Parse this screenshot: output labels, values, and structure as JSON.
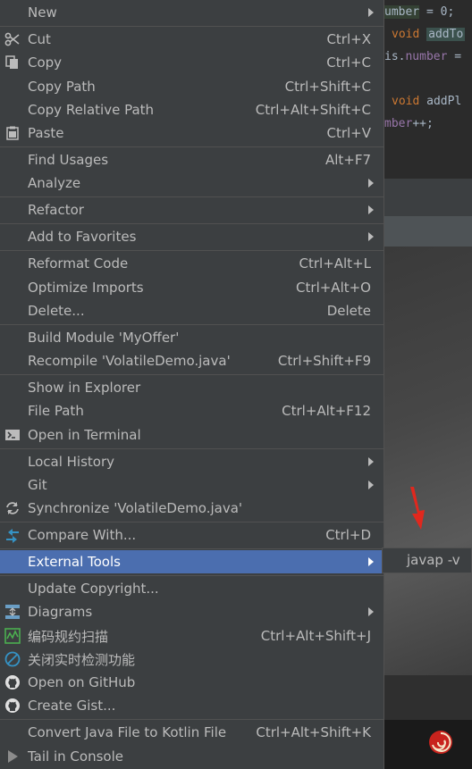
{
  "editor": {
    "line1_field": "umber",
    "line1_rest": " = 0;",
    "line2_kw": "void",
    "line2_method": "addTo",
    "line3_this": "is.",
    "line3_field": "number",
    "line3_rest": " =",
    "line5_kw": "void",
    "line5_method": "addPl",
    "line6_field": "mber",
    "line6_rest": "++;"
  },
  "menu": {
    "items": [
      {
        "label": "New",
        "shortcut": "",
        "submenu": true,
        "icon": ""
      },
      {
        "label": "Cut",
        "shortcut": "Ctrl+X",
        "submenu": false,
        "icon": "scissors-icon"
      },
      {
        "label": "Copy",
        "shortcut": "Ctrl+C",
        "submenu": false,
        "icon": "copy-icon"
      },
      {
        "label": "Copy Path",
        "shortcut": "Ctrl+Shift+C",
        "submenu": false,
        "icon": ""
      },
      {
        "label": "Copy Relative Path",
        "shortcut": "Ctrl+Alt+Shift+C",
        "submenu": false,
        "icon": ""
      },
      {
        "label": "Paste",
        "shortcut": "Ctrl+V",
        "submenu": false,
        "icon": "clipboard-icon"
      },
      {
        "label": "Find Usages",
        "shortcut": "Alt+F7",
        "submenu": false,
        "icon": ""
      },
      {
        "label": "Analyze",
        "shortcut": "",
        "submenu": true,
        "icon": ""
      },
      {
        "label": "Refactor",
        "shortcut": "",
        "submenu": true,
        "icon": ""
      },
      {
        "label": "Add to Favorites",
        "shortcut": "",
        "submenu": true,
        "icon": ""
      },
      {
        "label": "Reformat Code",
        "shortcut": "Ctrl+Alt+L",
        "submenu": false,
        "icon": ""
      },
      {
        "label": "Optimize Imports",
        "shortcut": "Ctrl+Alt+O",
        "submenu": false,
        "icon": ""
      },
      {
        "label": "Delete...",
        "shortcut": "Delete",
        "submenu": false,
        "icon": ""
      },
      {
        "label": "Build Module 'MyOffer'",
        "shortcut": "",
        "submenu": false,
        "icon": ""
      },
      {
        "label": "Recompile 'VolatileDemo.java'",
        "shortcut": "Ctrl+Shift+F9",
        "submenu": false,
        "icon": ""
      },
      {
        "label": "Show in Explorer",
        "shortcut": "",
        "submenu": false,
        "icon": ""
      },
      {
        "label": "File Path",
        "shortcut": "Ctrl+Alt+F12",
        "submenu": false,
        "icon": ""
      },
      {
        "label": "Open in Terminal",
        "shortcut": "",
        "submenu": false,
        "icon": "terminal-icon"
      },
      {
        "label": "Local History",
        "shortcut": "",
        "submenu": true,
        "icon": ""
      },
      {
        "label": "Git",
        "shortcut": "",
        "submenu": true,
        "icon": ""
      },
      {
        "label": "Synchronize 'VolatileDemo.java'",
        "shortcut": "",
        "submenu": false,
        "icon": "sync-icon"
      },
      {
        "label": "Compare With...",
        "shortcut": "Ctrl+D",
        "submenu": false,
        "icon": "compare-icon"
      },
      {
        "label": "External Tools",
        "shortcut": "",
        "submenu": true,
        "icon": "",
        "selected": true
      },
      {
        "label": "Update Copyright...",
        "shortcut": "",
        "submenu": false,
        "icon": ""
      },
      {
        "label": "Diagrams",
        "shortcut": "",
        "submenu": true,
        "icon": "diagram-icon"
      },
      {
        "label": "编码规约扫描",
        "shortcut": "Ctrl+Alt+Shift+J",
        "submenu": false,
        "icon": "scan-icon"
      },
      {
        "label": "关闭实时检测功能",
        "shortcut": "",
        "submenu": false,
        "icon": "disable-icon"
      },
      {
        "label": "Open on GitHub",
        "shortcut": "",
        "submenu": false,
        "icon": "github-icon"
      },
      {
        "label": "Create Gist...",
        "shortcut": "",
        "submenu": false,
        "icon": "github-icon"
      },
      {
        "label": "Convert Java File to Kotlin File",
        "shortcut": "Ctrl+Alt+Shift+K",
        "submenu": false,
        "icon": ""
      },
      {
        "label": "Tail in Console",
        "shortcut": "",
        "submenu": false,
        "icon": "play-icon"
      }
    ]
  },
  "submenu": {
    "items": [
      {
        "label": "javap -v"
      }
    ]
  },
  "colors": {
    "menu_bg": "#3c3f41",
    "selection": "#4b6eaf",
    "text": "#bbbbbb",
    "separator": "#515151",
    "arrow_annotation": "#e0281e"
  }
}
